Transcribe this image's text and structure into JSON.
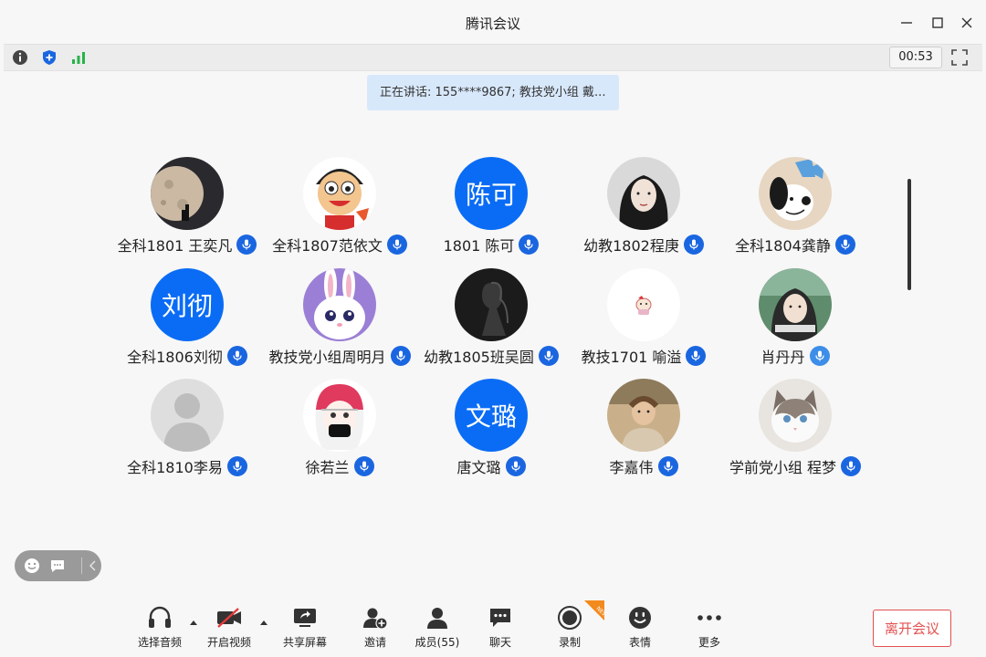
{
  "window": {
    "title": "腾讯会议"
  },
  "status": {
    "timer": "00:53",
    "icons": [
      "info-icon",
      "shield-icon",
      "signal-icon",
      "fullscreen-icon"
    ]
  },
  "speaking": {
    "text": "正在讲话: 155****9867; 教技党小组 戴..."
  },
  "participants": [
    {
      "name": "全科1801 王奕凡",
      "avatar_text": "",
      "avatar": "moon-photo"
    },
    {
      "name": "全科1807范依文",
      "avatar_text": "",
      "avatar": "cartoon-boy"
    },
    {
      "name": "1801 陈可",
      "avatar_text": "陈可",
      "avatar": "blue-initials"
    },
    {
      "name": "幼教1802程庚",
      "avatar_text": "",
      "avatar": "portrait-photo"
    },
    {
      "name": "全科1804龚静",
      "avatar_text": "",
      "avatar": "cartoon-dog"
    },
    {
      "name": "全科1806刘彻",
      "avatar_text": "刘彻",
      "avatar": "blue-initials"
    },
    {
      "name": "教技党小组周明月",
      "avatar_text": "",
      "avatar": "cartoon-bunny"
    },
    {
      "name": "幼教1805班吴圆",
      "avatar_text": "",
      "avatar": "dark-photo"
    },
    {
      "name": "教技1701 喻溢",
      "avatar_text": "",
      "avatar": "small-cartoon"
    },
    {
      "name": "肖丹丹",
      "avatar_text": "",
      "avatar": "girl-photo",
      "mic_state": "speaking"
    },
    {
      "name": "全科1810李易",
      "avatar_text": "",
      "avatar": "default-person"
    },
    {
      "name": "徐若兰",
      "avatar_text": "",
      "avatar": "anime-girl"
    },
    {
      "name": "唐文璐",
      "avatar_text": "文璐",
      "avatar": "blue-initials"
    },
    {
      "name": "李嘉伟",
      "avatar_text": "",
      "avatar": "man-photo"
    },
    {
      "name": "学前党小组 程梦",
      "avatar_text": "",
      "avatar": "cat-photo"
    }
  ],
  "toolbar": {
    "audio": "选择音频",
    "video": "开启视频",
    "share": "共享屏幕",
    "invite": "邀请",
    "members": "成员(55)",
    "chat": "聊天",
    "record": "录制",
    "reactions": "表情",
    "more": "更多",
    "leave": "离开会议",
    "record_badge": "NEW"
  },
  "colors": {
    "accent": "#0a6cf5",
    "leave": "#e45050",
    "banner": "#d8e8fb"
  }
}
